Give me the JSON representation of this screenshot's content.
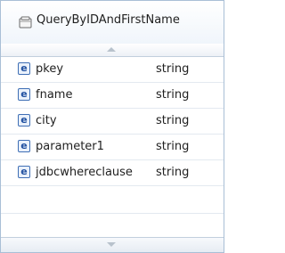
{
  "header": {
    "title": "QueryByIDAndFirstName",
    "icon": "business-object-icon"
  },
  "fields": [
    {
      "name": "pkey",
      "type": "string",
      "icon": "element-icon"
    },
    {
      "name": "fname",
      "type": "string",
      "icon": "element-icon"
    },
    {
      "name": "city",
      "type": "string",
      "icon": "element-icon"
    },
    {
      "name": "parameter1",
      "type": "string",
      "icon": "element-icon"
    },
    {
      "name": "jdbcwhereclause",
      "type": "string",
      "icon": "element-icon"
    }
  ],
  "field_icon_letter": "e",
  "colors": {
    "border": "#a9bfd6",
    "icon_accent": "#3f6fb5"
  }
}
